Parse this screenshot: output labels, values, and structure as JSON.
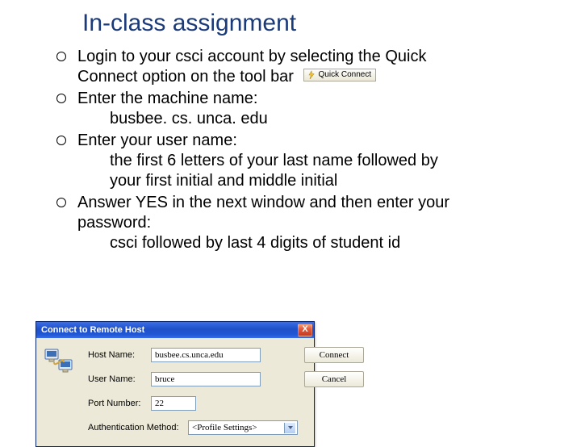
{
  "title": "In-class assignment",
  "bullets": {
    "b1_a": "Login to your csci account by selecting the Quick",
    "b1_b": "Connect option on the tool bar",
    "b2": "Enter the machine name:",
    "b2_indent": "busbee. cs. unca. edu",
    "b3": "Enter your user name:",
    "b3_indent_a": "the first 6 letters of your last name followed by",
    "b3_indent_b": " your first initial and middle initial",
    "b4_a": "Answer YES in the next window and then enter your",
    "b4_b": "password:",
    "b4_indent": "csci followed by last 4 digits of student id"
  },
  "quick_connect": {
    "label": "Quick Connect"
  },
  "dialog": {
    "title": "Connect to Remote Host",
    "close": "X",
    "labels": {
      "host": "Host Name:",
      "user": "User Name:",
      "port": "Port Number:",
      "auth": "Authentication Method:"
    },
    "values": {
      "host": "busbee.cs.unca.edu",
      "user": "bruce",
      "port": "22",
      "auth": "<Profile Settings>"
    },
    "buttons": {
      "connect": "Connect",
      "cancel": "Cancel"
    }
  }
}
